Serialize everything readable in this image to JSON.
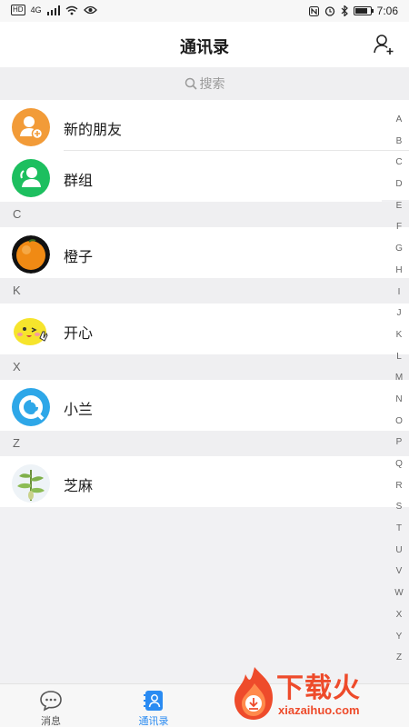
{
  "status_bar": {
    "left_indicators": [
      "HD",
      "4G"
    ],
    "time": "7:06"
  },
  "header": {
    "title": "通讯录",
    "action_icon": "add-contact-icon"
  },
  "search": {
    "placeholder": "搜索",
    "icon": "search-icon"
  },
  "top_entries": [
    {
      "label": "新的朋友",
      "icon": "new-friend-icon",
      "color": "#f29b38"
    },
    {
      "label": "群组",
      "icon": "group-icon",
      "color": "#1dbf5f"
    }
  ],
  "sections": [
    {
      "letter": "C",
      "contacts": [
        {
          "name": "橙子",
          "avatar": "orange-avatar"
        }
      ]
    },
    {
      "letter": "K",
      "contacts": [
        {
          "name": "开心",
          "avatar": "happy-face-avatar"
        }
      ]
    },
    {
      "letter": "X",
      "contacts": [
        {
          "name": "小兰",
          "avatar": "blue-circle-avatar"
        }
      ]
    },
    {
      "letter": "Z",
      "contacts": [
        {
          "name": "芝麻",
          "avatar": "sesame-plant-avatar"
        }
      ]
    }
  ],
  "alpha_index": [
    "A",
    "B",
    "C",
    "D",
    "E",
    "F",
    "G",
    "H",
    "I",
    "J",
    "K",
    "L",
    "M",
    "N",
    "O",
    "P",
    "Q",
    "R",
    "S",
    "T",
    "U",
    "V",
    "W",
    "X",
    "Y",
    "Z"
  ],
  "tabs": [
    {
      "label": "消息",
      "icon": "chat-bubble-icon",
      "active": false
    },
    {
      "label": "通讯录",
      "icon": "contacts-icon",
      "active": true
    }
  ],
  "watermark": {
    "text": "下载火",
    "url": "xiazaihuo.com"
  },
  "colors": {
    "accent": "#2a8bf2",
    "watermark": "#ee4b2b"
  }
}
